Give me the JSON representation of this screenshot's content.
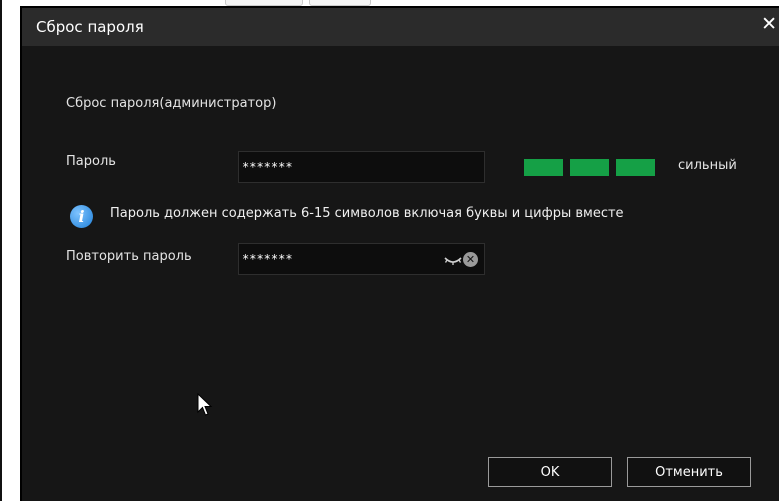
{
  "dialog": {
    "title": "Сброс пароля",
    "close_icon": "close-icon",
    "subtitle": "Сброс пароля(администратор)"
  },
  "password": {
    "label": "Пароль",
    "value": "*******",
    "strength_label": "сильный",
    "strength_segments": 3,
    "strength_color": "#15a046"
  },
  "info": {
    "icon": "info-icon",
    "text": "Пароль должен содержать 6-15 символов включая буквы и цифры вместе"
  },
  "confirm": {
    "label": "Повторить пароль",
    "value": "*******",
    "eye_icon": "eye-closed-icon",
    "clear_icon": "clear-icon"
  },
  "buttons": {
    "ok": "OK",
    "cancel": "Отменить"
  },
  "colors": {
    "dialog_bg": "#161616",
    "titlebar_bg": "#2b2b2b",
    "text": "#e4e4e4"
  }
}
